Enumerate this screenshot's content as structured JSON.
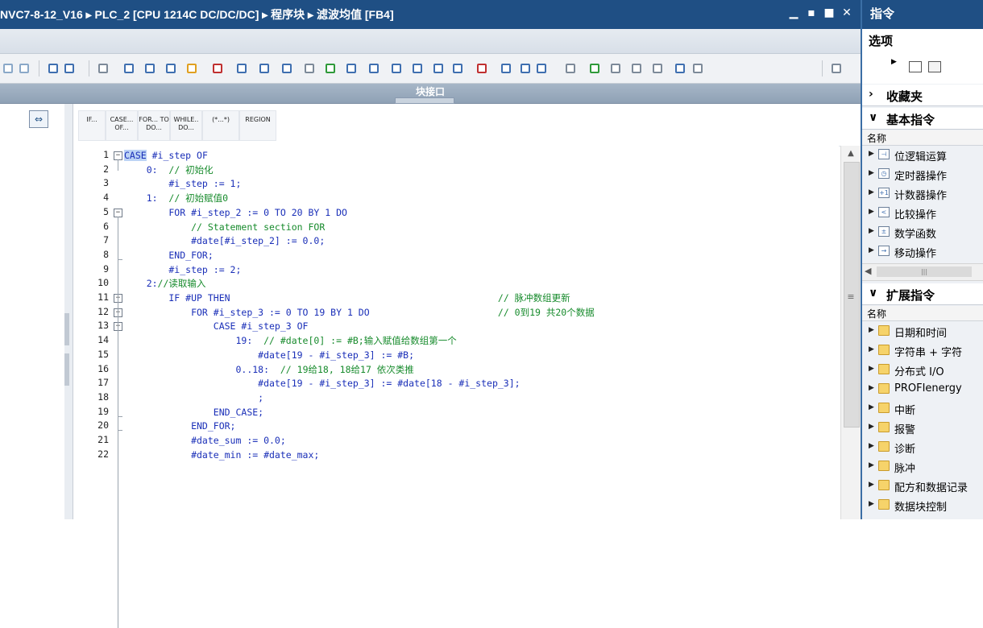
{
  "editor": {
    "title": "NVC7-8-12_V16 ▸ PLC_2 [CPU 1214C DC/DC/DC] ▸ 程序块 ▸ 滤波均值 [FB4]",
    "window_buttons": [
      "minimize",
      "restore",
      "maximize",
      "close"
    ],
    "interface_label": "块接口"
  },
  "code_buttons": [
    {
      "label": "IF..."
    },
    {
      "label": "CASE... OF..."
    },
    {
      "label": "FOR... TO DO..."
    },
    {
      "label": "WHILE.. DO..."
    },
    {
      "label": "(*...*)"
    },
    {
      "label": "REGION"
    }
  ],
  "code_lines": [
    {
      "n": "1",
      "fold": "open",
      "segs": [
        {
          "t": "CASE",
          "c": "kw sel"
        },
        {
          "t": " #i_step OF",
          "c": "tx"
        }
      ]
    },
    {
      "n": "2",
      "segs": [
        {
          "t": "    0:  ",
          "c": "tx"
        },
        {
          "t": "// 初始化",
          "c": "cm"
        }
      ]
    },
    {
      "n": "3",
      "segs": [
        {
          "t": "        #i_step := 1;",
          "c": "tx"
        }
      ]
    },
    {
      "n": "4",
      "segs": [
        {
          "t": "    1:  ",
          "c": "tx"
        },
        {
          "t": "// 初始赋值0",
          "c": "cm"
        }
      ]
    },
    {
      "n": "5",
      "fold": "open",
      "segs": [
        {
          "t": "        FOR #i_step_2 := 0 TO 20 BY 1 DO",
          "c": "tx"
        }
      ]
    },
    {
      "n": "6",
      "segs": [
        {
          "t": "            // Statement section FOR",
          "c": "cm"
        }
      ]
    },
    {
      "n": "7",
      "segs": [
        {
          "t": "            #date[#i_step_2] := 0.0;",
          "c": "tx"
        }
      ]
    },
    {
      "n": "8",
      "fold": "end",
      "segs": [
        {
          "t": "        END_FOR;",
          "c": "tx"
        }
      ]
    },
    {
      "n": "9",
      "segs": [
        {
          "t": "        #i_step := 2;",
          "c": "tx"
        }
      ]
    },
    {
      "n": "10",
      "segs": [
        {
          "t": "    2:",
          "c": "tx"
        },
        {
          "t": "//读取输入",
          "c": "cm"
        }
      ]
    },
    {
      "n": "11",
      "fold": "open",
      "segs": [
        {
          "t": "        IF #UP THEN                                                ",
          "c": "tx"
        },
        {
          "t": "// 脉冲数组更新",
          "c": "cm"
        }
      ]
    },
    {
      "n": "12",
      "fold": "open",
      "segs": [
        {
          "t": "            FOR #i_step_3 := 0 TO 19 BY 1 DO                       ",
          "c": "tx"
        },
        {
          "t": "// 0到19 共20个数据",
          "c": "cm"
        }
      ]
    },
    {
      "n": "13",
      "fold": "open",
      "segs": [
        {
          "t": "                CASE #i_step_3 OF",
          "c": "tx"
        }
      ]
    },
    {
      "n": "14",
      "segs": [
        {
          "t": "                    19:  ",
          "c": "tx"
        },
        {
          "t": "// #date[0] := #B;输入赋值给数组第一个",
          "c": "cm"
        }
      ]
    },
    {
      "n": "15",
      "segs": [
        {
          "t": "                        #date[19 - #i_step_3] := #B;",
          "c": "tx"
        }
      ]
    },
    {
      "n": "16",
      "segs": [
        {
          "t": "                    0..18:  ",
          "c": "tx"
        },
        {
          "t": "// 19给18, 18给17 依次类推",
          "c": "cm"
        }
      ]
    },
    {
      "n": "17",
      "segs": [
        {
          "t": "                        #date[19 - #i_step_3] := #date[18 - #i_step_3];",
          "c": "tx"
        }
      ]
    },
    {
      "n": "18",
      "segs": [
        {
          "t": "                        ;",
          "c": "tx"
        }
      ]
    },
    {
      "n": "19",
      "fold": "end",
      "segs": [
        {
          "t": "                END_CASE;",
          "c": "tx"
        }
      ]
    },
    {
      "n": "20",
      "fold": "end",
      "segs": [
        {
          "t": "            END_FOR;",
          "c": "tx"
        }
      ]
    },
    {
      "n": "21",
      "segs": [
        {
          "t": "            #date_sum := 0.0;",
          "c": "tx"
        }
      ]
    },
    {
      "n": "22",
      "segs": [
        {
          "t": "            #date_min := #date_max;",
          "c": "tx"
        }
      ]
    }
  ],
  "right_panel": {
    "title": "指令",
    "options_label": "选项",
    "favorites": {
      "label": "收藏夹",
      "expanded": false
    },
    "basic": {
      "label": "基本指令",
      "column": "名称",
      "items": [
        {
          "label": "位逻辑运算",
          "icon": "bitlogic-icon"
        },
        {
          "label": "定时器操作",
          "icon": "timer-icon"
        },
        {
          "label": "计数器操作",
          "icon": "counter-icon"
        },
        {
          "label": "比较操作",
          "icon": "compare-icon"
        },
        {
          "label": "数学函数",
          "icon": "math-icon"
        },
        {
          "label": "移动操作",
          "icon": "move-icon"
        }
      ]
    },
    "extended": {
      "label": "扩展指令",
      "column": "名称",
      "items": [
        {
          "label": "日期和时间"
        },
        {
          "label": "字符串 + 字符"
        },
        {
          "label": "分布式 I/O"
        },
        {
          "label": "PROFIenergy"
        },
        {
          "label": "中断"
        },
        {
          "label": "报警"
        },
        {
          "label": "诊断"
        },
        {
          "label": "脉冲"
        },
        {
          "label": "配方和数据记录"
        },
        {
          "label": "数据块控制"
        }
      ]
    }
  },
  "colors": {
    "accent": "#1f4f84",
    "keyword": "#1a2fb8",
    "comment": "#178b2c",
    "selection": "#bcd3f5"
  }
}
